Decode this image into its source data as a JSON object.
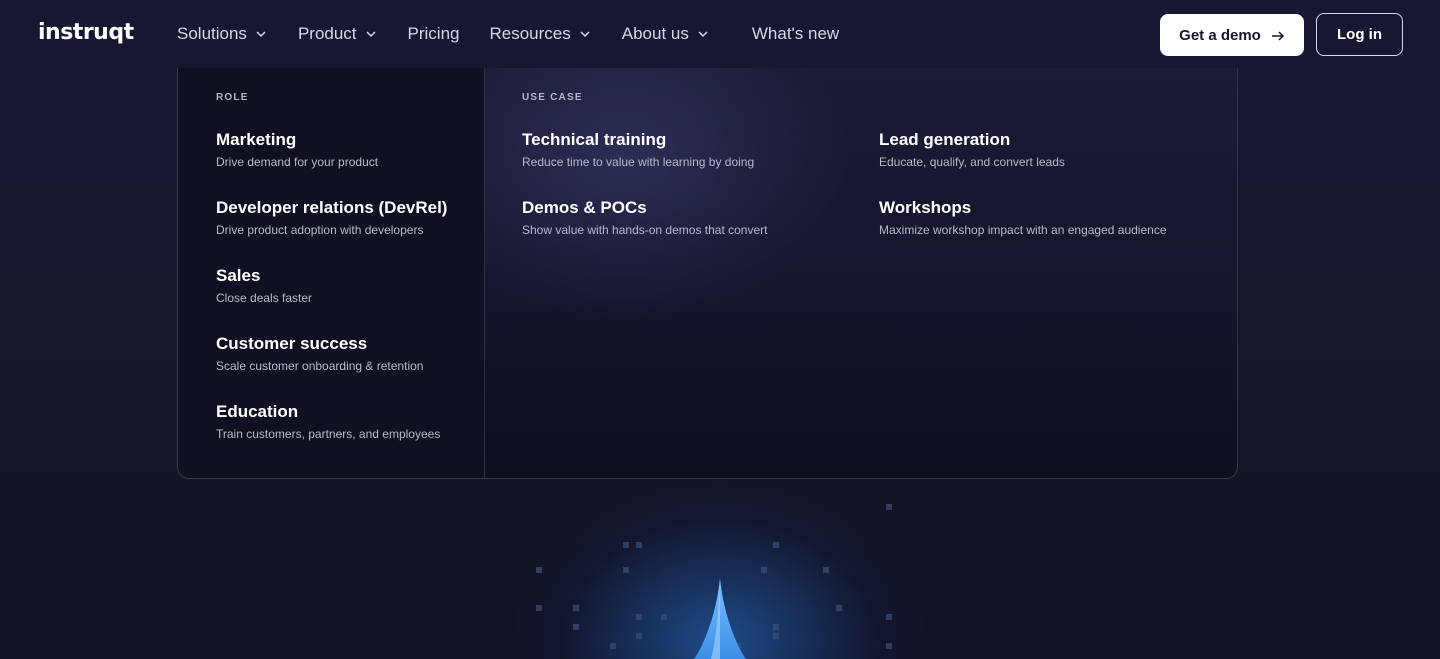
{
  "header": {
    "logo": "instruqt",
    "nav": [
      {
        "label": "Solutions",
        "has_dropdown": true
      },
      {
        "label": "Product",
        "has_dropdown": true
      },
      {
        "label": "Pricing",
        "has_dropdown": false
      },
      {
        "label": "Resources",
        "has_dropdown": true
      },
      {
        "label": "About us",
        "has_dropdown": true
      },
      {
        "label": "What's new",
        "has_dropdown": false
      }
    ],
    "demo_button": "Get a demo",
    "login_button": "Log in"
  },
  "dropdown": {
    "role": {
      "label": "ROLE",
      "items": [
        {
          "title": "Marketing",
          "desc": "Drive demand for your product"
        },
        {
          "title": "Developer relations (DevRel)",
          "desc": "Drive product adoption with developers"
        },
        {
          "title": "Sales",
          "desc": "Close deals faster"
        },
        {
          "title": "Customer success",
          "desc": "Scale customer onboarding & retention"
        },
        {
          "title": "Education",
          "desc": "Train customers, partners, and employees"
        }
      ]
    },
    "use_case": {
      "label": "USE CASE",
      "items": [
        {
          "title": "Technical training",
          "desc": "Reduce time to value with learning by doing"
        },
        {
          "title": "Lead generation",
          "desc": "Educate, qualify, and convert leads"
        },
        {
          "title": "Demos & POCs",
          "desc": "Show value with hands-on demos that convert"
        },
        {
          "title": "Workshops",
          "desc": "Maximize workshop impact with an engaged audience"
        }
      ]
    }
  },
  "colors": {
    "background": "#15162b",
    "panel": "#0e0f20",
    "accent_glow": "#2878dc",
    "text": "#ffffff",
    "muted_text": "#b7b8cc"
  },
  "icons": [
    "chevron-down-icon",
    "arrow-right-icon"
  ]
}
